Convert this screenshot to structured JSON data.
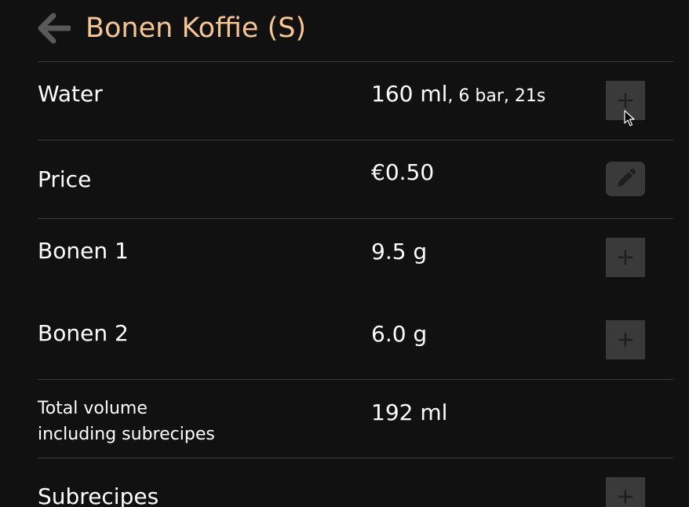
{
  "header": {
    "title": "Bonen Koffie (S)",
    "back_icon": "arrow-left-icon"
  },
  "rows": {
    "water": {
      "label": "Water",
      "value": "160 ml",
      "details": ", 6 bar, 21s",
      "action_icon": "plus-icon"
    },
    "price": {
      "label": "Price",
      "value": "€0.50",
      "action_icon": "pencil-icon"
    },
    "bonen1": {
      "label": "Bonen 1",
      "value": "9.5 g",
      "action_icon": "plus-icon"
    },
    "bonen2": {
      "label": "Bonen 2",
      "value": "6.0 g",
      "action_icon": "plus-icon"
    },
    "total": {
      "label_line1": "Total volume",
      "label_line2": "including subrecipes",
      "value": "192 ml"
    },
    "subrecipes": {
      "label": "Subrecipes",
      "action_icon": "plus-icon"
    }
  },
  "colors": {
    "background": "#111111",
    "title": "#f6c594",
    "text": "#ffffff",
    "button_bg": "#3a3a3a",
    "icon": "#1f1f1f",
    "back_arrow": "#595959",
    "divider": "#3a3a3a"
  }
}
